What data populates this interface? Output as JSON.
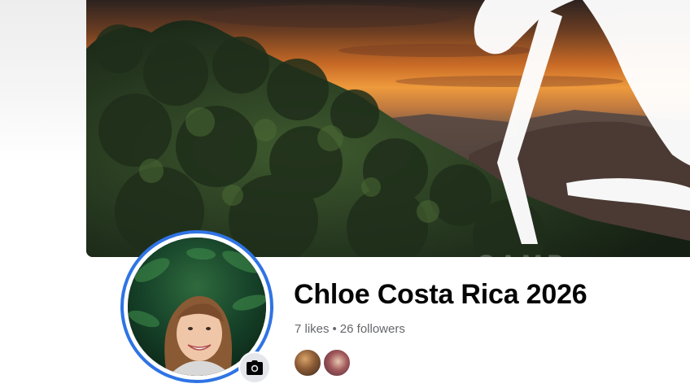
{
  "profile": {
    "name": "Chloe Costa Rica 2026",
    "likes": "7 likes",
    "separator": "•",
    "followers": "26 followers"
  },
  "icons": {
    "camera": "camera-icon"
  },
  "colors": {
    "avatar_ring": "#2f74e4",
    "name_text": "#050505",
    "stats_text": "#65676b",
    "camera_button_bg": "#e4e6eb"
  }
}
